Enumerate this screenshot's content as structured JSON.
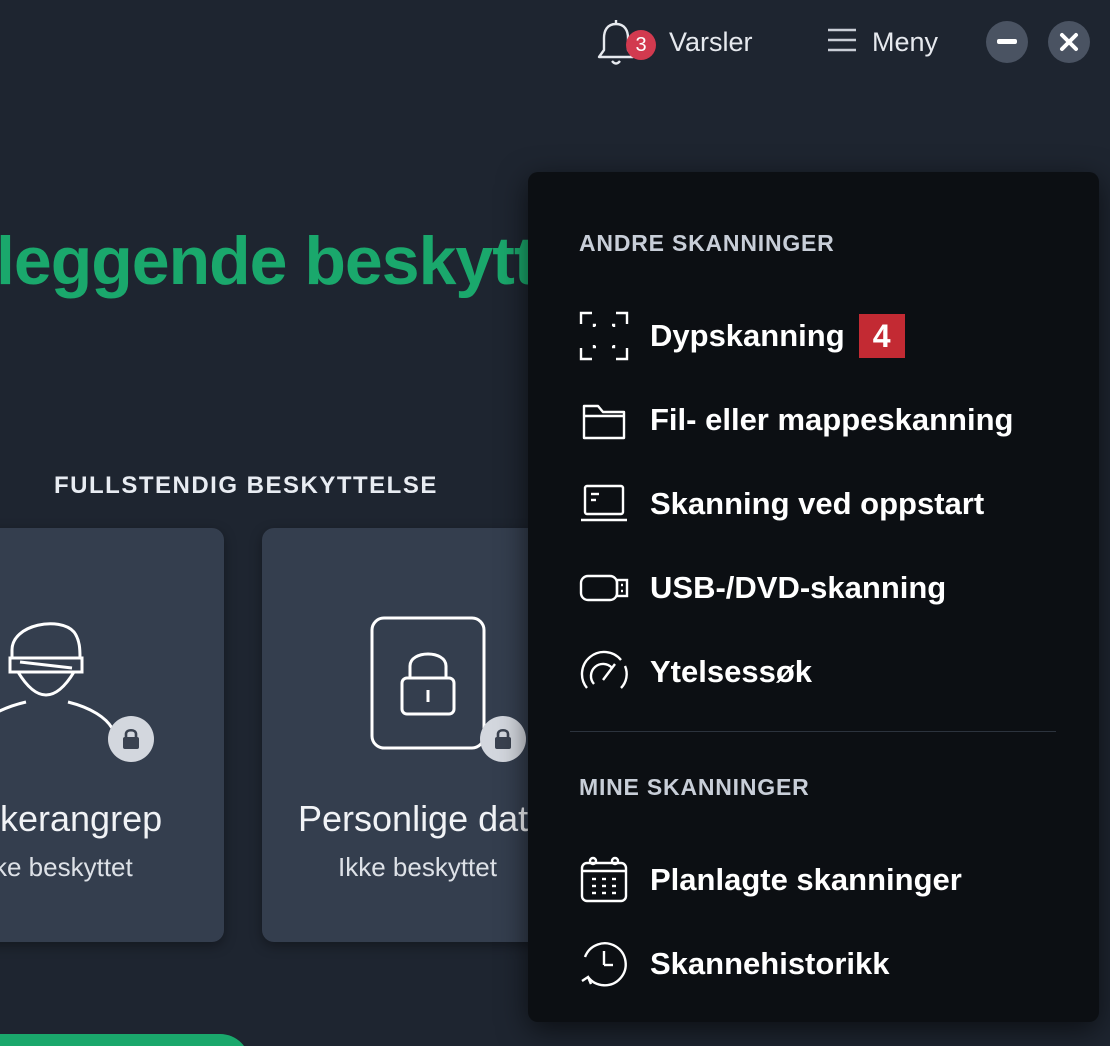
{
  "topbar": {
    "notifications": {
      "label": "Varsler",
      "count": "3",
      "icon": "bell-icon"
    },
    "menu": {
      "label": "Meny",
      "icon": "hamburger-icon"
    },
    "minimize_icon": "minimize-icon",
    "close_icon": "close-icon"
  },
  "hero": {
    "title": "leggende beskytte"
  },
  "protection": {
    "section_title": "FULLSTENDIG BESKYTTELSE",
    "cards": [
      {
        "title": "ckerangrep",
        "status": "ke beskyttet",
        "icon": "hacker-icon"
      },
      {
        "title": "Personlige dat",
        "status": "Ikke beskyttet",
        "icon": "padlock-icon"
      }
    ]
  },
  "dropdown": {
    "other_scans_header": "ANDRE SKANNINGER",
    "other_scans": [
      {
        "label": "Dypskanning",
        "icon": "scan-frame-icon",
        "step": "4"
      },
      {
        "label": "Fil- eller mappeskanning",
        "icon": "folder-icon"
      },
      {
        "label": "Skanning ved oppstart",
        "icon": "laptop-icon"
      },
      {
        "label": "USB-/DVD-skanning",
        "icon": "usb-icon"
      },
      {
        "label": "Ytelsessøk",
        "icon": "speedometer-icon"
      }
    ],
    "my_scans_header": "MINE SKANNINGER",
    "my_scans": [
      {
        "label": "Planlagte skanninger",
        "icon": "calendar-icon"
      },
      {
        "label": "Skannehistorikk",
        "icon": "history-icon"
      }
    ]
  },
  "colors": {
    "background": "#1e2530",
    "card": "#343e4e",
    "accent_green": "#1aa86c",
    "menu_bg": "#0c0f13",
    "badge_red": "#d23a4f",
    "step_red": "#c32a33"
  }
}
